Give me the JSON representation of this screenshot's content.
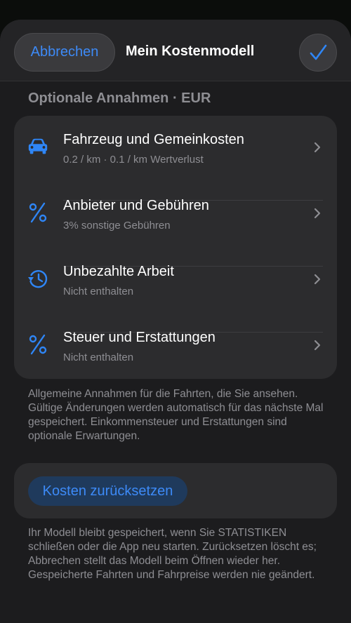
{
  "header": {
    "cancel_label": "Abbrechen",
    "title": "Mein Kostenmodell",
    "confirm_icon": "checkmark-icon"
  },
  "section": {
    "title": "Optionale Annahmen · EUR"
  },
  "rows": [
    {
      "icon": "car-icon",
      "title": "Fahrzeug und Gemeinkosten",
      "subtitle": "0.2 / km · 0.1 / km Wertverlust"
    },
    {
      "icon": "percent-icon",
      "title": "Anbieter und Gebühren",
      "subtitle": "3% sonstige Gebühren"
    },
    {
      "icon": "clock-history-icon",
      "title": "Unbezahlte Arbeit",
      "subtitle": "Nicht enthalten"
    },
    {
      "icon": "percent-icon",
      "title": "Steuer und Erstattungen",
      "subtitle": "Nicht enthalten"
    }
  ],
  "footer_note": "Allgemeine Annahmen für die Fahrten, die Sie ansehen. Gültige Änderungen werden automatisch für das nächste Mal gespeichert. Einkommensteuer und Erstattungen sind optionale Erwartungen.",
  "reset": {
    "label": "Kosten zurücksetzen",
    "note": "Ihr Modell bleibt gespeichert, wenn Sie STATISTIKEN schließen oder die App neu starten. Zurücksetzen löscht es; Abbrechen stellt das Modell beim Öffnen wieder her. Gespeicherte Fahrten und Fahrpreise werden nie geändert."
  },
  "colors": {
    "accent": "#2f86f6",
    "background": "#1c1c1e",
    "card": "#2c2c2e",
    "secondary_text": "#8e8e93"
  }
}
